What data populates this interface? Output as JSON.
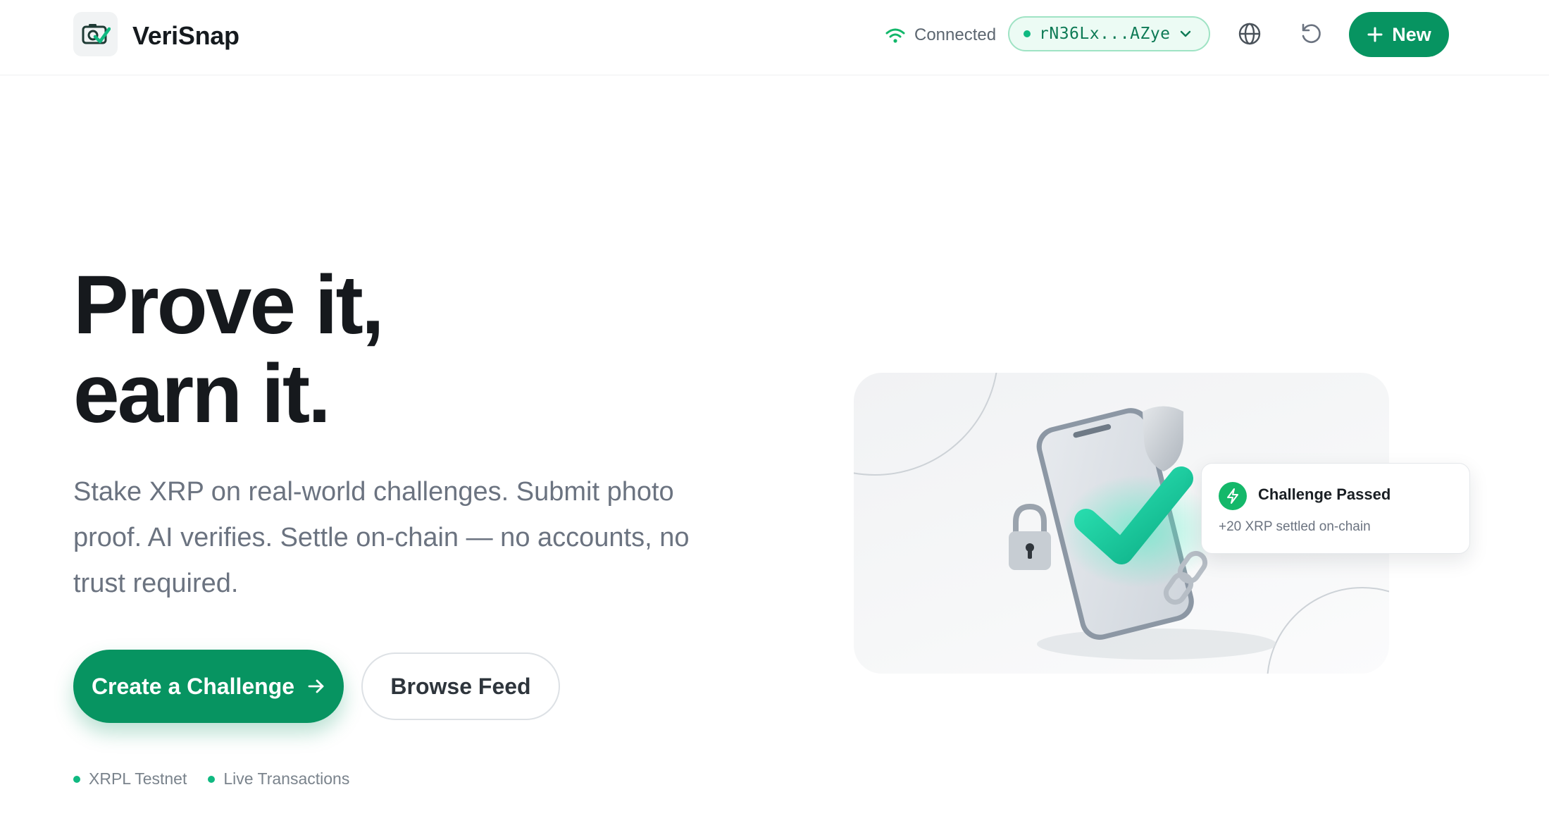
{
  "header": {
    "brand": "VeriSnap",
    "connection_status": "Connected",
    "wallet_address": "rN36Lx...AZye",
    "new_button_label": "New"
  },
  "hero": {
    "title_line1": "Prove it,",
    "title_line2": "earn it.",
    "subtitle": "Stake XRP on real-world challenges. Submit photo proof. AI verifies. Settle on-chain — no accounts, no trust required.",
    "primary_cta": "Create a Challenge",
    "secondary_cta": "Browse Feed"
  },
  "status_items": [
    {
      "label": "XRPL Testnet"
    },
    {
      "label": "Live Transactions"
    }
  ],
  "notification": {
    "title": "Challenge Passed",
    "subtitle": "+20 XRP settled on-chain"
  },
  "icons": {
    "logo": "camera-check-icon",
    "connection": "wifi-icon",
    "wallet_toggle": "chevron-down-icon",
    "language": "globe-icon",
    "reset": "refresh-icon",
    "new": "plus-icon",
    "cta_arrow": "arrow-right-icon",
    "notification": "lightning-icon"
  },
  "colors": {
    "accent": "#079461",
    "accent_light": "#ecfbf4",
    "status_dot": "#10b981",
    "heading": "#16191d",
    "muted_text": "#6b7380"
  }
}
